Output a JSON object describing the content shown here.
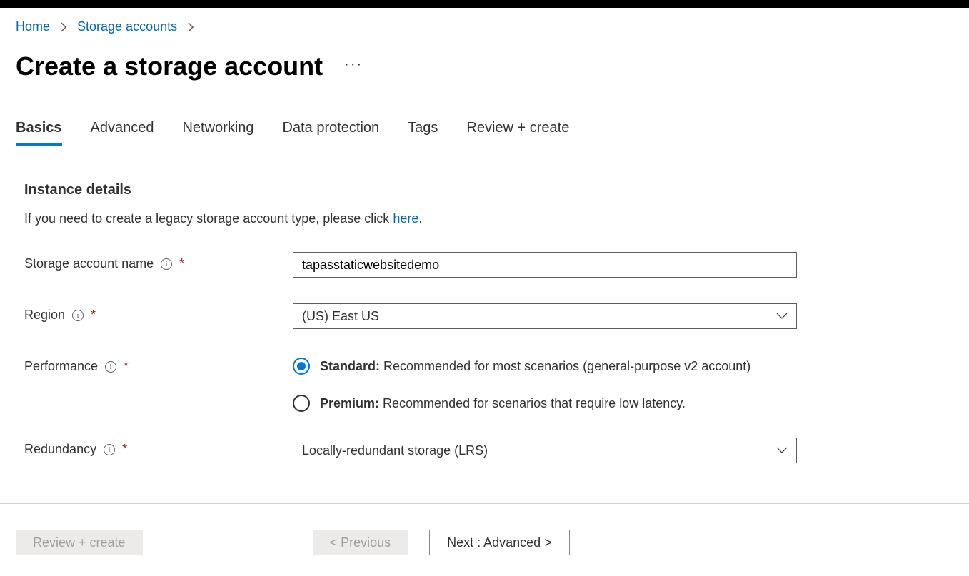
{
  "breadcrumb": {
    "home": "Home",
    "storage_accounts": "Storage accounts"
  },
  "page_title": "Create a storage account",
  "tabs": {
    "basics": "Basics",
    "advanced": "Advanced",
    "networking": "Networking",
    "data_protection": "Data protection",
    "tags": "Tags",
    "review": "Review + create"
  },
  "section": {
    "instance_details": "Instance details",
    "legacy_prefix": "If you need to create a legacy storage account type, please click ",
    "legacy_link": "here",
    "legacy_suffix": "."
  },
  "fields": {
    "storage_account_name": {
      "label": "Storage account name",
      "value": "tapasstaticwebsitedemo"
    },
    "region": {
      "label": "Region",
      "value": "(US) East US"
    },
    "performance": {
      "label": "Performance",
      "standard_bold": "Standard:",
      "standard_desc": " Recommended for most scenarios (general-purpose v2 account)",
      "premium_bold": "Premium:",
      "premium_desc": " Recommended for scenarios that require low latency."
    },
    "redundancy": {
      "label": "Redundancy",
      "value": "Locally-redundant storage (LRS)"
    }
  },
  "footer": {
    "review": "Review + create",
    "previous": "< Previous",
    "next": "Next : Advanced >"
  }
}
